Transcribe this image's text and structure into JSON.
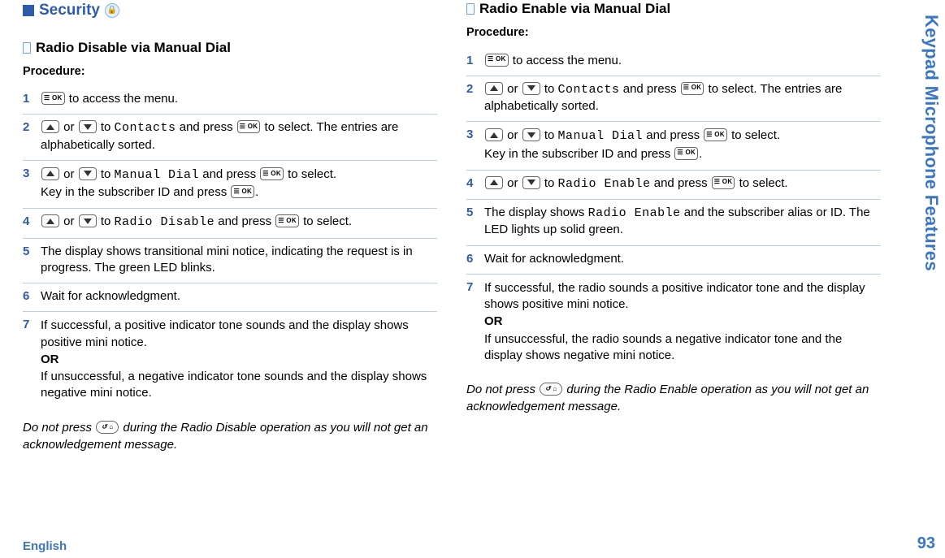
{
  "side_tab": "Keypad Microphone Features",
  "page_number": "93",
  "language": "English",
  "keys": {
    "ok": "☰ OK",
    "back": "↺ ⌂"
  },
  "left": {
    "section_title": "Security",
    "sub_title": "Radio Disable via Manual Dial",
    "procedure_label": "Procedure:",
    "steps": {
      "s1": {
        "num": "1",
        "t1": " to access the menu."
      },
      "s2": {
        "num": "2",
        "t_or": " or ",
        "t_to": " to ",
        "contacts": "Contacts",
        "t_press": " and press ",
        "t_sel": " to select. The entries are alphabetically sorted."
      },
      "s3": {
        "num": "3",
        "t_or": " or ",
        "t_to": " to ",
        "manual": "Manual Dial",
        "t_press": " and press ",
        "t_sel": " to select.",
        "line2a": "Key in the subscriber ID and press ",
        "line2b": "."
      },
      "s4": {
        "num": "4",
        "t_or": " or ",
        "t_to": " to ",
        "radio": "Radio Disable",
        "t_press": " and press ",
        "t_sel": " to select."
      },
      "s5": {
        "num": "5",
        "text": "The display shows transitional mini notice, indicating the request is in progress. The green LED blinks."
      },
      "s6": {
        "num": "6",
        "text": "Wait for acknowledgment."
      },
      "s7": {
        "num": "7",
        "l1": "If successful, a positive indicator tone sounds and the display shows positive mini notice.",
        "or": "OR",
        "l2": "If unsuccessful, a negative indicator tone sounds and the display shows negative mini notice."
      }
    },
    "footnote_a": "Do not press ",
    "footnote_b": " during the Radio  Disable operation as you will not get an acknowledgement message."
  },
  "right": {
    "sub_title": "Radio Enable via Manual Dial",
    "procedure_label": "Procedure:",
    "steps": {
      "s1": {
        "num": "1",
        "t1": " to access the menu."
      },
      "s2": {
        "num": "2",
        "t_or": " or ",
        "t_to": " to ",
        "contacts": "Contacts",
        "t_press": " and press ",
        "t_sel": " to select. The entries are alphabetically sorted."
      },
      "s3": {
        "num": "3",
        "t_or": " or ",
        "t_to": " to ",
        "manual": "Manual Dial",
        "t_press": " and press ",
        "t_sel": " to select.",
        "line2a": "Key in the subscriber ID and press ",
        "line2b": "."
      },
      "s4": {
        "num": "4",
        "t_or": " or ",
        "t_to": " to ",
        "radio": "Radio Enable",
        "t_press": " and press ",
        "t_sel": " to select."
      },
      "s5": {
        "num": "5",
        "t1": "The display shows ",
        "radio": "Radio Enable",
        "t2": " and the subscriber alias or ID. The LED lights up solid green."
      },
      "s6": {
        "num": "6",
        "text": "Wait for acknowledgment."
      },
      "s7": {
        "num": "7",
        "l1": "If successful, the radio sounds a positive indicator tone and the display shows positive mini notice.",
        "or": "OR",
        "l2": "If unsuccessful, the radio sounds a negative indicator tone and the display shows negative mini notice."
      }
    },
    "footnote_a": "Do not press ",
    "footnote_b": " during the Radio Enable operation as you will not get an acknowledgement message."
  }
}
